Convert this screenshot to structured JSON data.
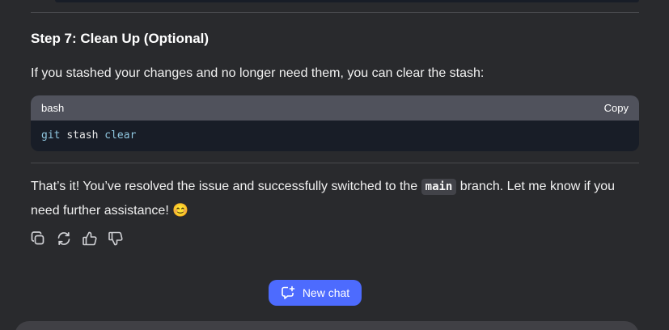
{
  "step": {
    "heading": "Step 7: Clean Up (Optional)",
    "intro": "If you stashed your changes and no longer need them, you can clear the stash:"
  },
  "code": {
    "language": "bash",
    "copy_label": "Copy",
    "tokens": {
      "cmd": "git",
      "sub": "stash",
      "arg": "clear"
    }
  },
  "closing": {
    "before": "That’s it! You’ve resolved the issue and successfully switched to the ",
    "branch": "main",
    "after": " branch. Let me know if you",
    "line2": "need further assistance! ",
    "emoji": "😊"
  },
  "new_chat_label": "New chat",
  "colors": {
    "accent": "#4d6bfe",
    "background": "#292a2d",
    "code_header": "#50525c",
    "code_bg": "#181d27"
  },
  "icons": [
    "copy-icon",
    "regenerate-icon",
    "thumbs-up-icon",
    "thumbs-down-icon",
    "new-chat-icon"
  ]
}
